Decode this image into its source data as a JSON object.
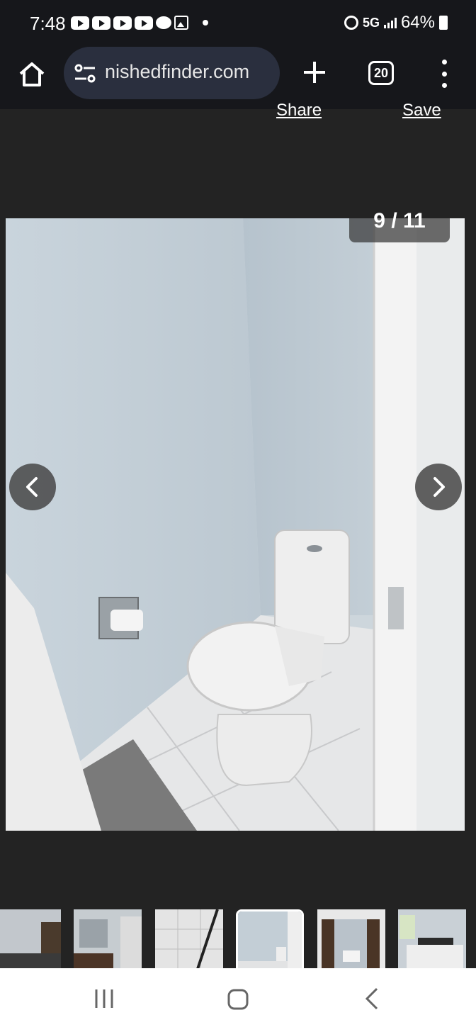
{
  "status_bar": {
    "time": "7:48",
    "network": "5G",
    "battery": "64%"
  },
  "browser": {
    "url": "nishedfinder.com",
    "tab_count": "20"
  },
  "page": {
    "share_label": "Share",
    "save_label": "Save"
  },
  "gallery": {
    "counter": "9 / 11",
    "current_index": 9,
    "total": 11,
    "thumbnails": [
      {
        "name": "thumbnail-bedroom-barn-door"
      },
      {
        "name": "thumbnail-bathroom-vanity"
      },
      {
        "name": "thumbnail-shower"
      },
      {
        "name": "thumbnail-toilet-room"
      },
      {
        "name": "thumbnail-bedroom-doorway"
      },
      {
        "name": "thumbnail-bedroom-bed"
      }
    ]
  }
}
